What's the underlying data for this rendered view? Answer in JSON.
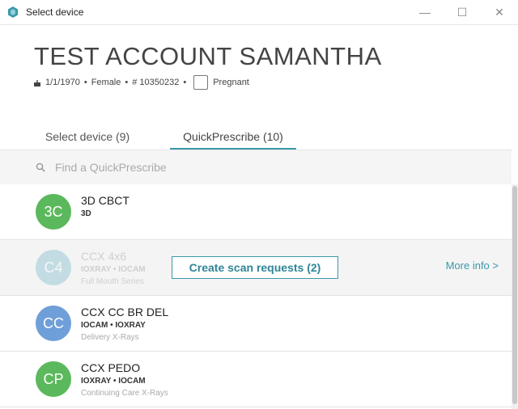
{
  "window": {
    "title": "Select device",
    "minimize": "—",
    "maximize": "☐",
    "close": "✕"
  },
  "patient": {
    "name": "TEST ACCOUNT SAMANTHA",
    "dob": "1/1/1970",
    "gender": "Female",
    "id": "# 10350232",
    "pregnant_label": "Pregnant",
    "dot": "•"
  },
  "tabs": [
    {
      "label": "Select device (9)"
    },
    {
      "label": "QuickPrescribe (10)"
    }
  ],
  "search": {
    "placeholder": "Find a QuickPrescribe"
  },
  "items": [
    {
      "initials": "3C",
      "title": "3D CBCT",
      "sub": "3D",
      "desc": "",
      "color": "#5cb85c"
    },
    {
      "initials": "C4",
      "title": "CCX 4x6",
      "sub": "IOXRAY • IOCAM",
      "desc": "Full Mouth Series",
      "color": "#6ab0c8"
    },
    {
      "initials": "CC",
      "title": "CCX CC BR DEL",
      "sub": "IOCAM • IOXRAY",
      "desc": "Delivery X-Rays",
      "color": "#6f9fd8"
    },
    {
      "initials": "CP",
      "title": "CCX PEDO",
      "sub": "IOXRAY • IOCAM",
      "desc": "Continuing Care X-Rays",
      "color": "#5cb85c"
    }
  ],
  "actions": {
    "create_scan": "Create scan requests (2)",
    "more_info": "More info >"
  },
  "colors": {
    "accent": "#3a98a8"
  }
}
